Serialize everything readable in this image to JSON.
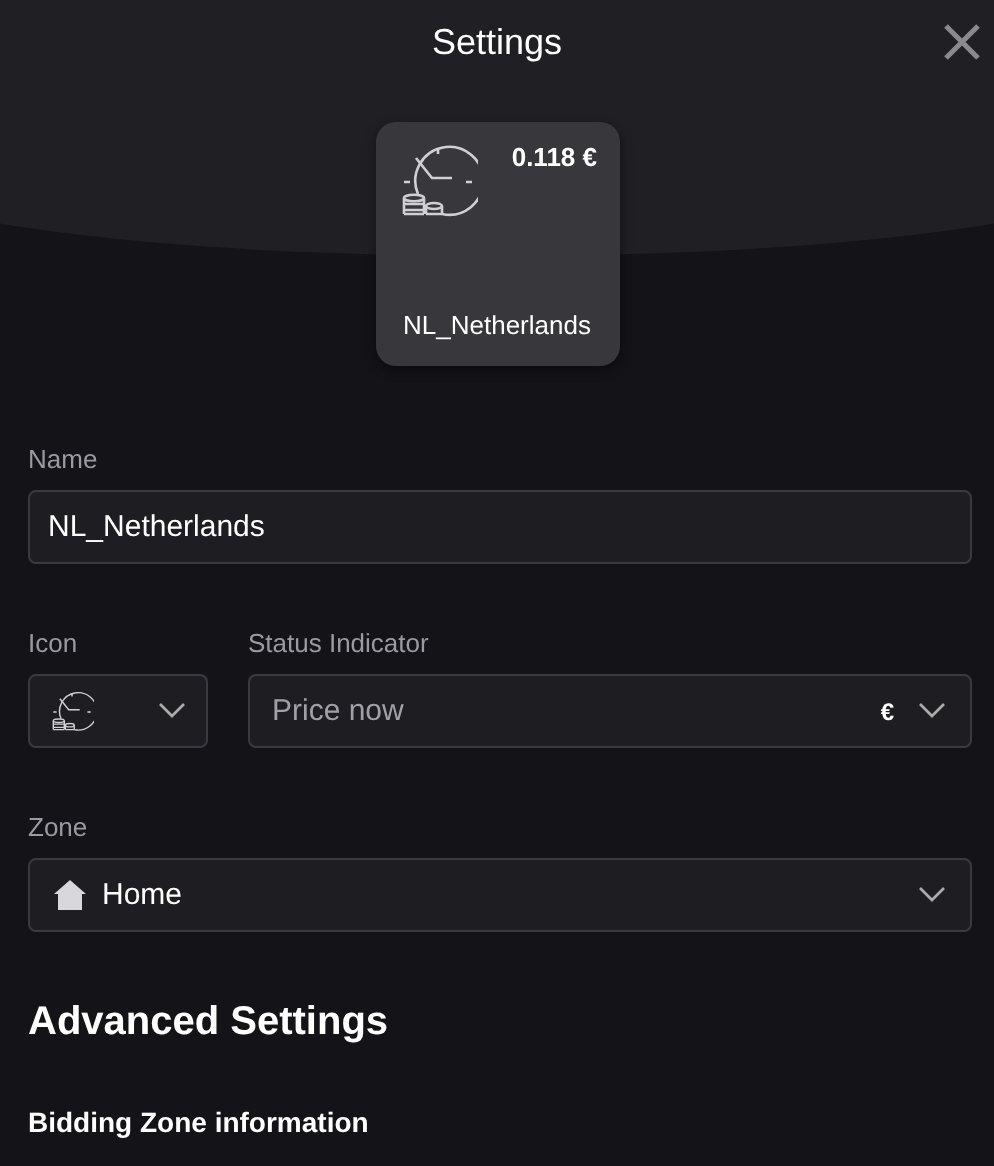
{
  "window": {
    "title": "Settings"
  },
  "preview": {
    "price": "0.118 €",
    "name": "NL_Netherlands"
  },
  "name_field": {
    "label": "Name",
    "value": "NL_Netherlands"
  },
  "icon_field": {
    "label": "Icon"
  },
  "status_field": {
    "label": "Status Indicator",
    "value": "Price now",
    "unit": "€"
  },
  "zone_field": {
    "label": "Zone",
    "value": "Home"
  },
  "sections": [
    {
      "kind": "heading",
      "text": "Advanced Settings"
    },
    {
      "kind": "subheading",
      "text": "Bidding Zone information"
    }
  ]
}
